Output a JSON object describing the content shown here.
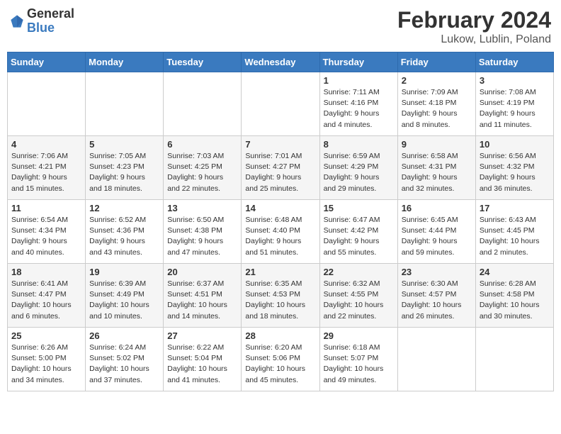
{
  "header": {
    "logo_general": "General",
    "logo_blue": "Blue",
    "month_year": "February 2024",
    "location": "Lukow, Lublin, Poland"
  },
  "days_of_week": [
    "Sunday",
    "Monday",
    "Tuesday",
    "Wednesday",
    "Thursday",
    "Friday",
    "Saturday"
  ],
  "weeks": [
    [
      {
        "day": "",
        "info": ""
      },
      {
        "day": "",
        "info": ""
      },
      {
        "day": "",
        "info": ""
      },
      {
        "day": "",
        "info": ""
      },
      {
        "day": "1",
        "info": "Sunrise: 7:11 AM\nSunset: 4:16 PM\nDaylight: 9 hours\nand 4 minutes."
      },
      {
        "day": "2",
        "info": "Sunrise: 7:09 AM\nSunset: 4:18 PM\nDaylight: 9 hours\nand 8 minutes."
      },
      {
        "day": "3",
        "info": "Sunrise: 7:08 AM\nSunset: 4:19 PM\nDaylight: 9 hours\nand 11 minutes."
      }
    ],
    [
      {
        "day": "4",
        "info": "Sunrise: 7:06 AM\nSunset: 4:21 PM\nDaylight: 9 hours\nand 15 minutes."
      },
      {
        "day": "5",
        "info": "Sunrise: 7:05 AM\nSunset: 4:23 PM\nDaylight: 9 hours\nand 18 minutes."
      },
      {
        "day": "6",
        "info": "Sunrise: 7:03 AM\nSunset: 4:25 PM\nDaylight: 9 hours\nand 22 minutes."
      },
      {
        "day": "7",
        "info": "Sunrise: 7:01 AM\nSunset: 4:27 PM\nDaylight: 9 hours\nand 25 minutes."
      },
      {
        "day": "8",
        "info": "Sunrise: 6:59 AM\nSunset: 4:29 PM\nDaylight: 9 hours\nand 29 minutes."
      },
      {
        "day": "9",
        "info": "Sunrise: 6:58 AM\nSunset: 4:31 PM\nDaylight: 9 hours\nand 32 minutes."
      },
      {
        "day": "10",
        "info": "Sunrise: 6:56 AM\nSunset: 4:32 PM\nDaylight: 9 hours\nand 36 minutes."
      }
    ],
    [
      {
        "day": "11",
        "info": "Sunrise: 6:54 AM\nSunset: 4:34 PM\nDaylight: 9 hours\nand 40 minutes."
      },
      {
        "day": "12",
        "info": "Sunrise: 6:52 AM\nSunset: 4:36 PM\nDaylight: 9 hours\nand 43 minutes."
      },
      {
        "day": "13",
        "info": "Sunrise: 6:50 AM\nSunset: 4:38 PM\nDaylight: 9 hours\nand 47 minutes."
      },
      {
        "day": "14",
        "info": "Sunrise: 6:48 AM\nSunset: 4:40 PM\nDaylight: 9 hours\nand 51 minutes."
      },
      {
        "day": "15",
        "info": "Sunrise: 6:47 AM\nSunset: 4:42 PM\nDaylight: 9 hours\nand 55 minutes."
      },
      {
        "day": "16",
        "info": "Sunrise: 6:45 AM\nSunset: 4:44 PM\nDaylight: 9 hours\nand 59 minutes."
      },
      {
        "day": "17",
        "info": "Sunrise: 6:43 AM\nSunset: 4:45 PM\nDaylight: 10 hours\nand 2 minutes."
      }
    ],
    [
      {
        "day": "18",
        "info": "Sunrise: 6:41 AM\nSunset: 4:47 PM\nDaylight: 10 hours\nand 6 minutes."
      },
      {
        "day": "19",
        "info": "Sunrise: 6:39 AM\nSunset: 4:49 PM\nDaylight: 10 hours\nand 10 minutes."
      },
      {
        "day": "20",
        "info": "Sunrise: 6:37 AM\nSunset: 4:51 PM\nDaylight: 10 hours\nand 14 minutes."
      },
      {
        "day": "21",
        "info": "Sunrise: 6:35 AM\nSunset: 4:53 PM\nDaylight: 10 hours\nand 18 minutes."
      },
      {
        "day": "22",
        "info": "Sunrise: 6:32 AM\nSunset: 4:55 PM\nDaylight: 10 hours\nand 22 minutes."
      },
      {
        "day": "23",
        "info": "Sunrise: 6:30 AM\nSunset: 4:57 PM\nDaylight: 10 hours\nand 26 minutes."
      },
      {
        "day": "24",
        "info": "Sunrise: 6:28 AM\nSunset: 4:58 PM\nDaylight: 10 hours\nand 30 minutes."
      }
    ],
    [
      {
        "day": "25",
        "info": "Sunrise: 6:26 AM\nSunset: 5:00 PM\nDaylight: 10 hours\nand 34 minutes."
      },
      {
        "day": "26",
        "info": "Sunrise: 6:24 AM\nSunset: 5:02 PM\nDaylight: 10 hours\nand 37 minutes."
      },
      {
        "day": "27",
        "info": "Sunrise: 6:22 AM\nSunset: 5:04 PM\nDaylight: 10 hours\nand 41 minutes."
      },
      {
        "day": "28",
        "info": "Sunrise: 6:20 AM\nSunset: 5:06 PM\nDaylight: 10 hours\nand 45 minutes."
      },
      {
        "day": "29",
        "info": "Sunrise: 6:18 AM\nSunset: 5:07 PM\nDaylight: 10 hours\nand 49 minutes."
      },
      {
        "day": "",
        "info": ""
      },
      {
        "day": "",
        "info": ""
      }
    ]
  ]
}
